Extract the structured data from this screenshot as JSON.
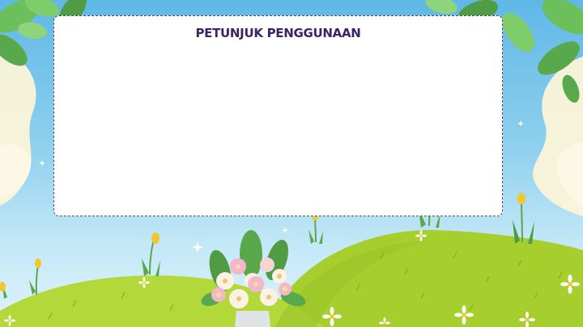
{
  "slide": {
    "title": "PETUNJUK PENGGUNAAN",
    "body": ""
  },
  "theme": {
    "sky_top": "#5fb8e6",
    "sky_bottom": "#dff3fb",
    "hill_green": "#a6cf2e",
    "leaf_green": "#6cbf5a",
    "title_color": "#3b2466",
    "panel_border": "#4a4a5a"
  }
}
